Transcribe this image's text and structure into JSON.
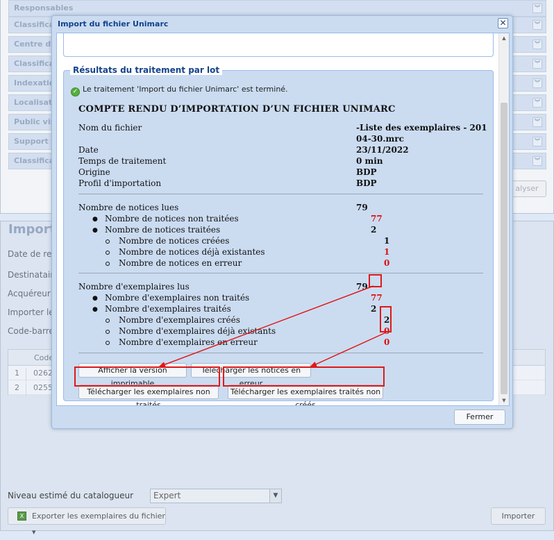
{
  "background": {
    "accordion_rows": [
      "Responsables",
      "Classificat",
      "Centre d'i",
      "Classificat",
      "Indexatio",
      "Localisatio",
      "Public vis",
      "Support",
      "Classificat"
    ],
    "analyser_label": "alyser",
    "section_title": "Import",
    "form_labels": [
      "Date de reto",
      "Destinataire",
      "Acquéreur",
      "Importer les",
      "Code-barres"
    ],
    "grid": {
      "header": "Code",
      "rows": [
        {
          "num": "1",
          "code": "02623"
        },
        {
          "num": "2",
          "code": "02554"
        }
      ]
    },
    "niveau_label": "Niveau estimé du catalogueur",
    "niveau_value": "Expert",
    "export_button": "Exporter les exemplaires du fichier",
    "importer_button": "Importer"
  },
  "modal": {
    "title": "Import du fichier Unimarc",
    "fieldset_legend": "Résultats du traitement par lot",
    "status_message": "Le traitement 'Import du fichier Unimarc' est terminé.",
    "report_title": "COMPTE RENDU D’IMPORTATION D’UN FICHIER UNIMARC",
    "info": {
      "nom_label": "Nom du fichier",
      "nom_value_1": "-Liste des exemplaires - 201",
      "nom_value_2": "04-30.mrc",
      "date_label": "Date",
      "date_value": "23/11/2022",
      "temps_label": "Temps de traitement",
      "temps_value": "0 min",
      "origine_label": "Origine",
      "origine_value": "BDP",
      "profil_label": "Profil d'importation",
      "profil_value": "BDP"
    },
    "notices": {
      "lues_label": "Nombre de notices lues",
      "lues_value": "79",
      "non_traitees_label": "Nombre de notices non traitées",
      "non_traitees_value": "77",
      "traitees_label": "Nombre de notices traitées",
      "traitees_value": "2",
      "creees_label": "Nombre de notices créées",
      "creees_value": "1",
      "existantes_label": "Nombre de notices déjà existantes",
      "existantes_value": "1",
      "erreur_label": "Nombre de notices en erreur",
      "erreur_value": "0"
    },
    "exemplaires": {
      "lus_label": "Nombre d'exemplaires lus",
      "lus_value": "79",
      "non_traites_label": "Nombre d'exemplaires non traités",
      "non_traites_value": "77",
      "traites_label": "Nombre d'exemplaires traités",
      "traites_value": "2",
      "crees_label": "Nombre d'exemplaires créés",
      "crees_value": "2",
      "existants_label": "Nombre d'exemplaires déjà existants",
      "existants_value": "0",
      "erreur_label": "Nombre d'exemplaires en erreur",
      "erreur_value": "0"
    },
    "buttons": {
      "imprimable": "Afficher la version imprimable",
      "notices_erreur": "Télécharger les notices en erreur",
      "exemplaires_non_traites": "Télécharger les exemplaires non traités",
      "exemplaires_non_crees": "Télécharger les exemplaires traités non créés",
      "fermer": "Fermer"
    }
  },
  "colors": {
    "highlight_red": "#dd1111",
    "annotation_red": "#e01818",
    "title_blue": "#15428b"
  }
}
